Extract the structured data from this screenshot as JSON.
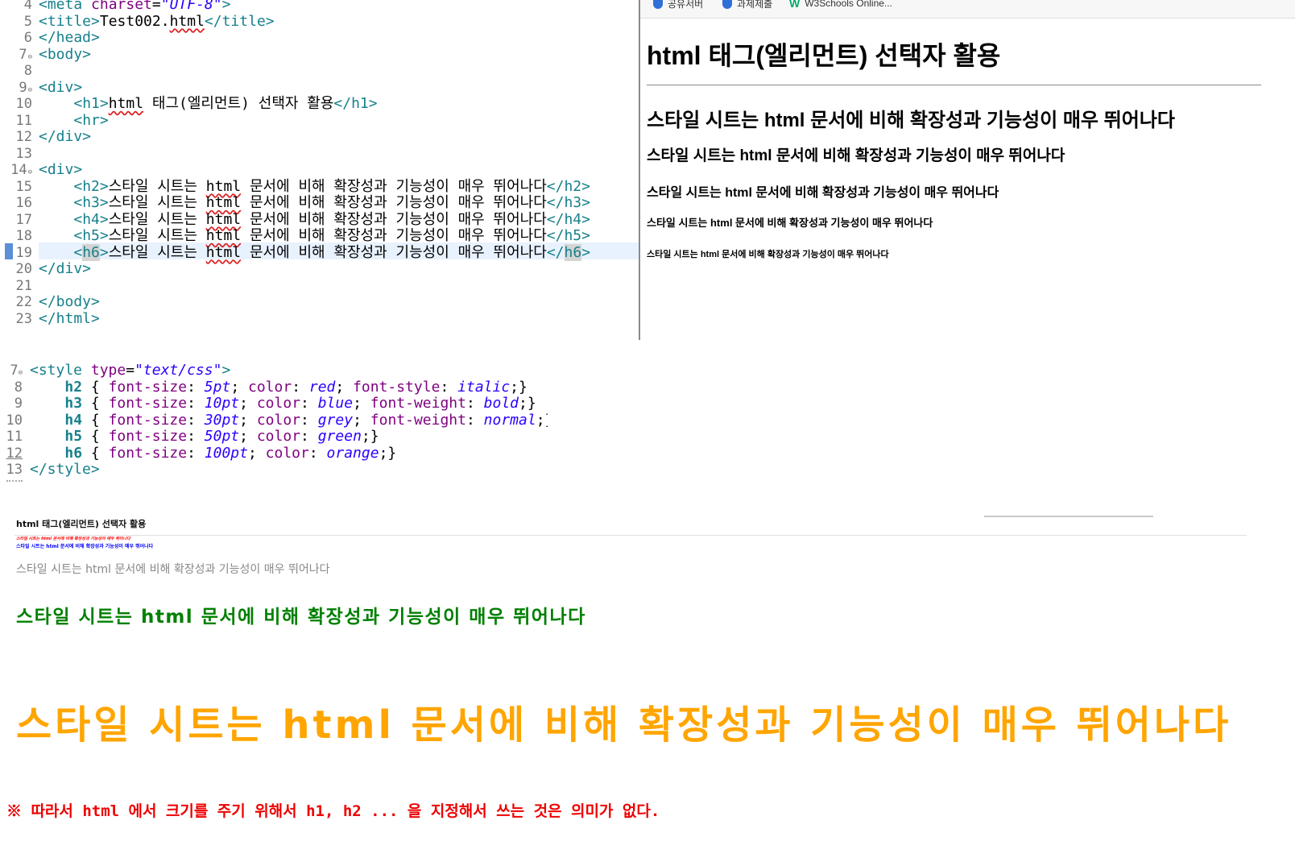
{
  "editor1": {
    "gutter": [
      "4",
      "5",
      "6",
      "7",
      "8",
      "9",
      "10",
      "11",
      "12",
      "13",
      "14",
      "15",
      "16",
      "17",
      "18",
      "19",
      "20",
      "21",
      "22",
      "23"
    ],
    "meta_open": "<meta ",
    "meta_attr": "charset",
    "meta_eq": "=",
    "meta_val": "\"UTF-8\"",
    "meta_close": ">",
    "title_open": "<title>",
    "title_text": "Test002.",
    "title_ext": "html",
    "title_close": "</title>",
    "head_close": "</head>",
    "body_open": "<body>",
    "div_open": "<div>",
    "h1_open": "<h1>",
    "h1_html": "html",
    "h1_rest": " 태그(엘리먼트) 선택자 활용",
    "h1_close": "</h1>",
    "hr": "<hr>",
    "div_close": "</div>",
    "heading_text_pre": "스타일 시트는 ",
    "heading_html": "html",
    "heading_text_post": " 문서에 비해 확장성과 기능성이 매우 뛰어나다",
    "h2_open": "<h2>",
    "h2_close": "</h2>",
    "h3_open": "<h3>",
    "h3_close": "</h3>",
    "h4_open": "<h4>",
    "h4_close": "</h4>",
    "h5_open": "<h5>",
    "h5_close": "</h5>",
    "h6_open_lt": "<",
    "h6_open_name": "h6",
    "h6_open_gt": ">",
    "h6_close_lt": "</",
    "h6_close_name": "h6",
    "h6_close_gt": ">",
    "body_close": "</body>",
    "html_close": "</html>"
  },
  "browser1": {
    "bookmarks": [
      "공유서버",
      "과제제출",
      "W3Schools Online..."
    ],
    "h1": "html 태그(엘리먼트) 선택자 활용",
    "headings": [
      "스타일 시트는 html 문서에 비해 확장성과 기능성이 매우 뛰어나다",
      "스타일 시트는 html 문서에 비해 확장성과 기능성이 매우 뛰어나다",
      "스타일 시트는 html 문서에 비해 확장성과 기능성이 매우 뛰어나다",
      "스타일 시트는 html 문서에 비해 확장성과 기능성이 매우 뛰어나다",
      "스타일 시트는 html 문서에 비해 확장성과 기능성이 매우 뛰어나다"
    ]
  },
  "editor2": {
    "gutter": [
      "7",
      "8",
      "9",
      "10",
      "11",
      "12",
      "13"
    ],
    "style_open_lt": "<style ",
    "style_attr": "type",
    "style_eq": "=",
    "style_val": "\"text/css\"",
    "style_gt": ">",
    "rules": [
      {
        "sel": "h2",
        "p1": "font-size",
        "v1": "5pt",
        "p2": "color",
        "v2": "red",
        "p3": "font-style",
        "v3": "italic"
      },
      {
        "sel": "h3",
        "p1": "font-size",
        "v1": "10pt",
        "p2": "color",
        "v2": "blue",
        "p3": "font-weight",
        "v3": "bold"
      },
      {
        "sel": "h4",
        "p1": "font-size",
        "v1": "30pt",
        "p2": "color",
        "v2": "grey",
        "p3": "font-weight",
        "v3": "normal"
      },
      {
        "sel": "h5",
        "p1": "font-size",
        "v1": "50pt",
        "p2": "color",
        "v2": "green"
      },
      {
        "sel": "h6",
        "p1": "font-size",
        "v1": "100pt",
        "p2": "color",
        "v2": "orange"
      }
    ],
    "style_close": "</style>"
  },
  "browser2": {
    "h1": "html 태그(엘리먼트) 선택자 활용",
    "h2": "스타일 시트는 html 문서에 비해 확장성과 기능성이 매우 뛰어나다",
    "h3": "스타일 시트는 html 문서에 비해 확장성과 기능성이 매우 뛰어나다",
    "h4": "스타일 시트는 html 문서에 비해 확장성과 기능성이 매우 뛰어나다",
    "h5": "스타일 시트는 html 문서에 비해 확장성과 기능성이 매우 뛰어나다",
    "h6": "스타일 시트는 html 문서에 비해 확장성과 기능성이 매우 뛰어나다"
  },
  "note": "※ 따라서 html 에서 크기를 주기 위해서 h1, h2 ... 을 지정해서 쓰는 것은 의미가 없다.",
  "colors": {
    "tag": "#17808c",
    "attr": "#7f007f",
    "string": "#2a00ff",
    "note": "#e00000"
  }
}
